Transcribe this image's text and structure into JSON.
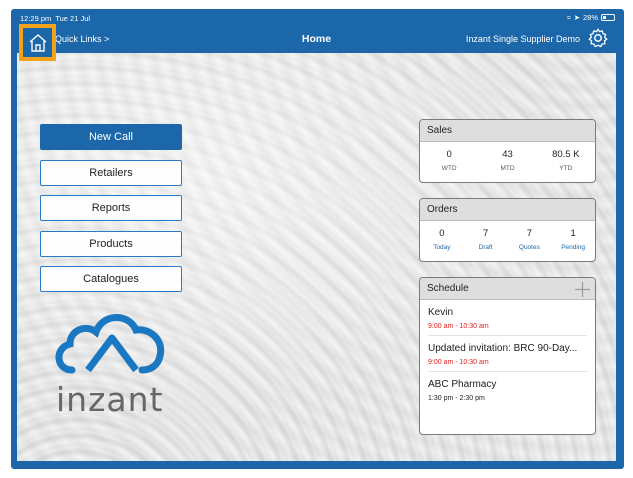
{
  "status_bar": {
    "time": "12:29 pm",
    "date": "Tue 21 Jul",
    "battery": "28%"
  },
  "nav": {
    "quick_links": "Quick Links >",
    "title": "Home",
    "account": "Inzant Single Supplier Demo"
  },
  "menu": [
    "New Call",
    "Retailers",
    "Reports",
    "Products",
    "Catalogues"
  ],
  "logo": {
    "word": "inzant"
  },
  "sales": {
    "title": "Sales",
    "stats": [
      {
        "value": "0",
        "label": "WTD"
      },
      {
        "value": "43",
        "label": "MTD"
      },
      {
        "value": "80.5 K",
        "label": "YTD"
      }
    ]
  },
  "orders": {
    "title": "Orders",
    "stats": [
      {
        "value": "0",
        "label": "Today"
      },
      {
        "value": "7",
        "label": "Draft"
      },
      {
        "value": "7",
        "label": "Quotes"
      },
      {
        "value": "1",
        "label": "Pending"
      }
    ]
  },
  "schedule": {
    "title": "Schedule",
    "items": [
      {
        "title": "Kevin",
        "time": "9:00 am - 10:30 am"
      },
      {
        "title": "Updated invitation: BRC 90-Day...",
        "time": "9:00 am - 10:30 am"
      },
      {
        "title": "ABC Pharmacy",
        "time": "1:30 pm - 2:30 pm"
      }
    ]
  },
  "colors": {
    "brand": "#1c67aa",
    "highlight": "#f5a21b",
    "alert": "#d8231f"
  }
}
